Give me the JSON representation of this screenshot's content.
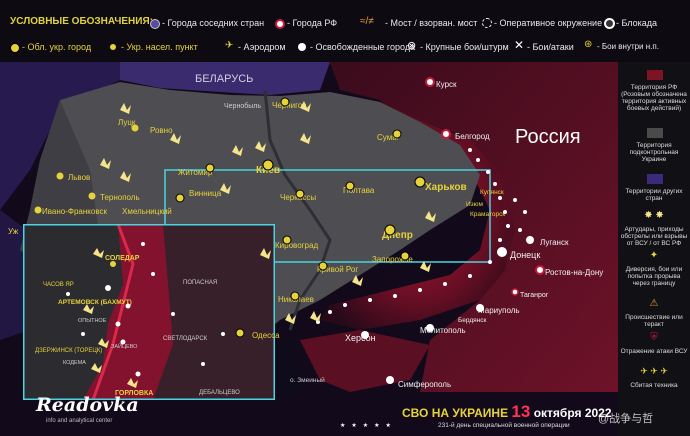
{
  "legend": {
    "title": "УСЛОВНЫЕ ОБОЗНАЧЕНИЯ:",
    "items": [
      {
        "label": "- Города соседних стран"
      },
      {
        "label": "- Города РФ"
      },
      {
        "label": "- Мост / взорван. мост"
      },
      {
        "label": "- Оперативное окружение"
      },
      {
        "label": "- Блокада"
      },
      {
        "label": "- Обл. укр. город"
      },
      {
        "label": "- Укр. насел. пункт"
      },
      {
        "label": "- Аэродром"
      },
      {
        "label": "- Освобожденные города"
      },
      {
        "label": "- Крупные бои/штурм"
      },
      {
        "label": "- Бои/атаки"
      },
      {
        "label": "- Бои внутри н.п."
      }
    ]
  },
  "side_legend": [
    {
      "label": "Территория РФ (Розовым обозначена территория активных боевых действий)",
      "color": "#7d1424"
    },
    {
      "label": "Территория подконтрольная Украине",
      "color": "#4a4a4a"
    },
    {
      "label": "Территории других стран",
      "color": "#3b2a7a"
    },
    {
      "label": "Артудары, приходы обстрелы или взрывы от ВСУ / от ВС РФ",
      "icon": "explosion-icon"
    },
    {
      "label": "Диверсия, бои или попытка прорыва через границу",
      "icon": "sabotage-icon"
    },
    {
      "label": "Происшествие или теракт",
      "icon": "incident-icon"
    },
    {
      "label": "Отражение атаки ВСУ",
      "icon": "shield-icon"
    },
    {
      "label": "Сбитая техника",
      "icon": "plane-icon"
    }
  ],
  "countries": {
    "belarus": "БЕЛАРУСЬ",
    "russia": "Россия"
  },
  "cities": {
    "lutsk": "Луцк",
    "rovno": "Ровно",
    "lvov": "Львов",
    "ternopol": "Тернополь",
    "khmelnitsky": "Хмельницкий",
    "ivano": "Ивано-Франковск",
    "uzh": "Уж",
    "zhitomir": "Житомир",
    "vinnitsa": "Винница",
    "kiev": "Киев",
    "chernigov": "Чернигов",
    "chernobyl": "Чернобыль",
    "sumy": "Сумы",
    "kursk": "Курск",
    "belgorod": "Белгород",
    "kharkov": "Харьков",
    "poltava": "Полтава",
    "cherkassy": "Черкассы",
    "kirovograd": "Кировоград",
    "dnepr": "Днепр",
    "zaporozhye": "Запорожье",
    "krivoy": "Кривой Рог",
    "nikolaev": "Николаев",
    "odessa": "Одесса",
    "kherson": "Херсон",
    "melitopol": "Мелитополь",
    "mariupol": "Мариуполь",
    "berdyansk": "Бердянск",
    "simferopol": "Симферополь",
    "donetsk": "Донецк",
    "lugansk": "Луганск",
    "rostov": "Ростов-на-Дону",
    "taganrog": "Таганрог",
    "zmeiny": "о. Змеиный",
    "kramatorsk": "Краматорск",
    "izum": "Изюм",
    "kupyansk": "Купянск"
  },
  "inset": {
    "labels": {
      "soledar": "СОЛЕДАР",
      "artemovsk": "АРТЕМОВСК (БАХМУТ)",
      "chasov": "ЧАСОВ ЯР",
      "dzerzhinsk": "ДЗЕРЖИНСК (ТОРЕЦК)",
      "gorlovka": "ГОРЛОВКА",
      "svetlodarsk": "СВЕТЛОДАРСК",
      "popasnaya": "ПОПАСНАЯ",
      "debaltsevo": "ДЕБАЛЬЦЕВО",
      "zaitsevo": "ЗАЙЦЕВО",
      "bakhmut_suburb": "ОПЫТНОЕ",
      "kodema": "КОДЕМА"
    }
  },
  "footer": {
    "brand": "Readovka",
    "brand_sub": "info and analytical center",
    "title_prefix": "СВО НА УКРАИНЕ",
    "day": "13",
    "month_year": "октября 2022",
    "subtitle": "231-й день специальной военной операции"
  },
  "watermark": "@战争与哲"
}
